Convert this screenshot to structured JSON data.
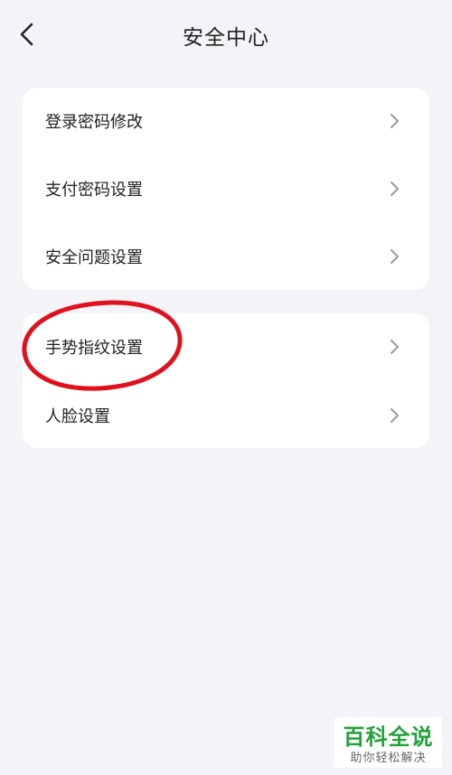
{
  "header": {
    "title": "安全中心",
    "back_icon": "chevron-left-icon"
  },
  "groups": [
    {
      "items": [
        {
          "label": "登录密码修改",
          "icon": "chevron-right-icon"
        },
        {
          "label": "支付密码设置",
          "icon": "chevron-right-icon"
        },
        {
          "label": "安全问题设置",
          "icon": "chevron-right-icon"
        }
      ]
    },
    {
      "items": [
        {
          "label": "手势指纹设置",
          "icon": "chevron-right-icon"
        },
        {
          "label": "人脸设置",
          "icon": "chevron-right-icon"
        }
      ]
    }
  ],
  "annotation": {
    "highlighted_item": "手势指纹设置",
    "color": "#e0101c"
  },
  "watermark": {
    "main": "百科全说",
    "sub": "助你轻松解决"
  },
  "colors": {
    "background": "#f4f3f8",
    "card": "#ffffff",
    "text": "#222222",
    "chevron": "#9a9a9a",
    "watermark_green": "#22a33a"
  }
}
